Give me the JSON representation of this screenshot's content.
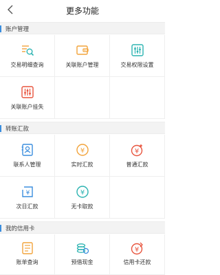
{
  "header": {
    "title": "更多功能",
    "back_icon": "chevron-left-icon"
  },
  "colors": {
    "accent": "#3a8dde",
    "teal": "#2bb3b1",
    "orange": "#f2a33a",
    "red": "#e8533c"
  },
  "sections": [
    {
      "title": "账户管理",
      "items": [
        {
          "label": "交易明细查询",
          "icon": "detail-search-icon"
        },
        {
          "label": "关联账户管理",
          "icon": "wallet-icon"
        },
        {
          "label": "交易权限设置",
          "icon": "settings-sliders-icon"
        },
        {
          "label": "关联账户挂失",
          "icon": "report-loss-icon"
        }
      ]
    },
    {
      "title": "转账汇款",
      "items": [
        {
          "label": "联系人管理",
          "icon": "contact-icon"
        },
        {
          "label": "实时汇款",
          "icon": "realtime-transfer-icon"
        },
        {
          "label": "普通汇款",
          "icon": "normal-transfer-icon"
        },
        {
          "label": "次日汇款",
          "icon": "next-day-transfer-icon"
        },
        {
          "label": "无卡取款",
          "icon": "cardless-withdraw-icon"
        }
      ]
    },
    {
      "title": "我的信用卡",
      "items": [
        {
          "label": "账单查询",
          "icon": "bill-query-icon"
        },
        {
          "label": "预借现金",
          "icon": "cash-advance-icon"
        },
        {
          "label": "信用卡还款",
          "icon": "card-repay-icon"
        }
      ]
    }
  ]
}
